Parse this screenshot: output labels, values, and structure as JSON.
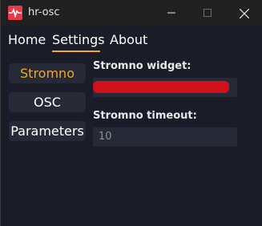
{
  "window": {
    "title": "hr-osc",
    "accent_color": "#f5a623",
    "icon": "heartbeat-icon"
  },
  "menu": {
    "items": [
      {
        "label": "Home"
      },
      {
        "label": "Settings"
      },
      {
        "label": "About"
      }
    ],
    "active": "Settings"
  },
  "sidebar": {
    "items": [
      {
        "label": "Stromno"
      },
      {
        "label": "OSC"
      },
      {
        "label": "Parameters"
      }
    ],
    "active": "Stromno"
  },
  "form": {
    "widget_label": "Stromno widget:",
    "widget_value": "",
    "timeout_label": "Stromno timeout:",
    "timeout_placeholder": "10"
  }
}
